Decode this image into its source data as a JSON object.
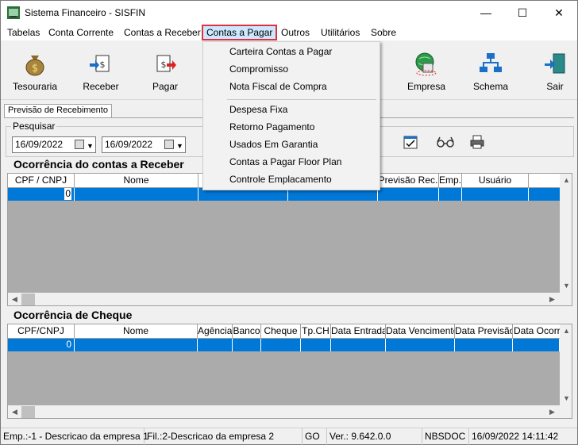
{
  "window": {
    "title": "Sistema Financeiro - SISFIN"
  },
  "menu": [
    "Tabelas",
    "Conta Corrente",
    "Contas a Receber",
    "Contas a Pagar",
    "Outros",
    "Utilitários",
    "Sobre"
  ],
  "toolbar": {
    "tesouraria": "Tesouraria",
    "receber": "Receber",
    "pagar": "Pagar",
    "empresa": "Empresa",
    "schema": "Schema",
    "sair": "Sair"
  },
  "tab": "Previsão de Recebimento",
  "search": {
    "label": "Pesquisar",
    "date_from": "16/09/2022",
    "date_to": "16/09/2022"
  },
  "receber": {
    "title": "Ocorrência do contas a Receber",
    "columns": [
      "CPF / CNPJ",
      "Nome",
      "",
      "",
      "Previsão Rec.",
      "Emp.",
      "Usuário",
      "Da"
    ],
    "first_cell": "0"
  },
  "cheque": {
    "title": "Ocorrência de Cheque",
    "columns": [
      "CPF/CNPJ",
      "Nome",
      "Agência",
      "Banco",
      "Cheque",
      "Tp.CH",
      "Data Entrada",
      "Data Vencimento",
      "Data Previsão",
      "Data Ocorrê"
    ],
    "first_cell": "0"
  },
  "dropdown": {
    "items_group1": [
      "Carteira Contas a Pagar",
      "Compromisso",
      "Nota Fiscal de Compra"
    ],
    "items_group2": [
      "Despesa Fixa",
      "Retorno Pagamento",
      "Usados Em Garantia",
      "Contas a Pagar Floor Plan",
      "Controle Emplacamento"
    ]
  },
  "status": {
    "emp": "Emp.:-1 - Descricao da empresa 1",
    "fil": "Fil.:2-Descricao da empresa 2",
    "uf": "GO",
    "ver": "Ver.: 9.642.0.0",
    "db": "NBSDOC",
    "datetime": "16/09/2022 14:11:42"
  },
  "colors": {
    "selection": "#0078d7",
    "grid_bg": "#ababab",
    "menu_highlight": "#cce8ff",
    "menu_border": "#e0323c"
  }
}
